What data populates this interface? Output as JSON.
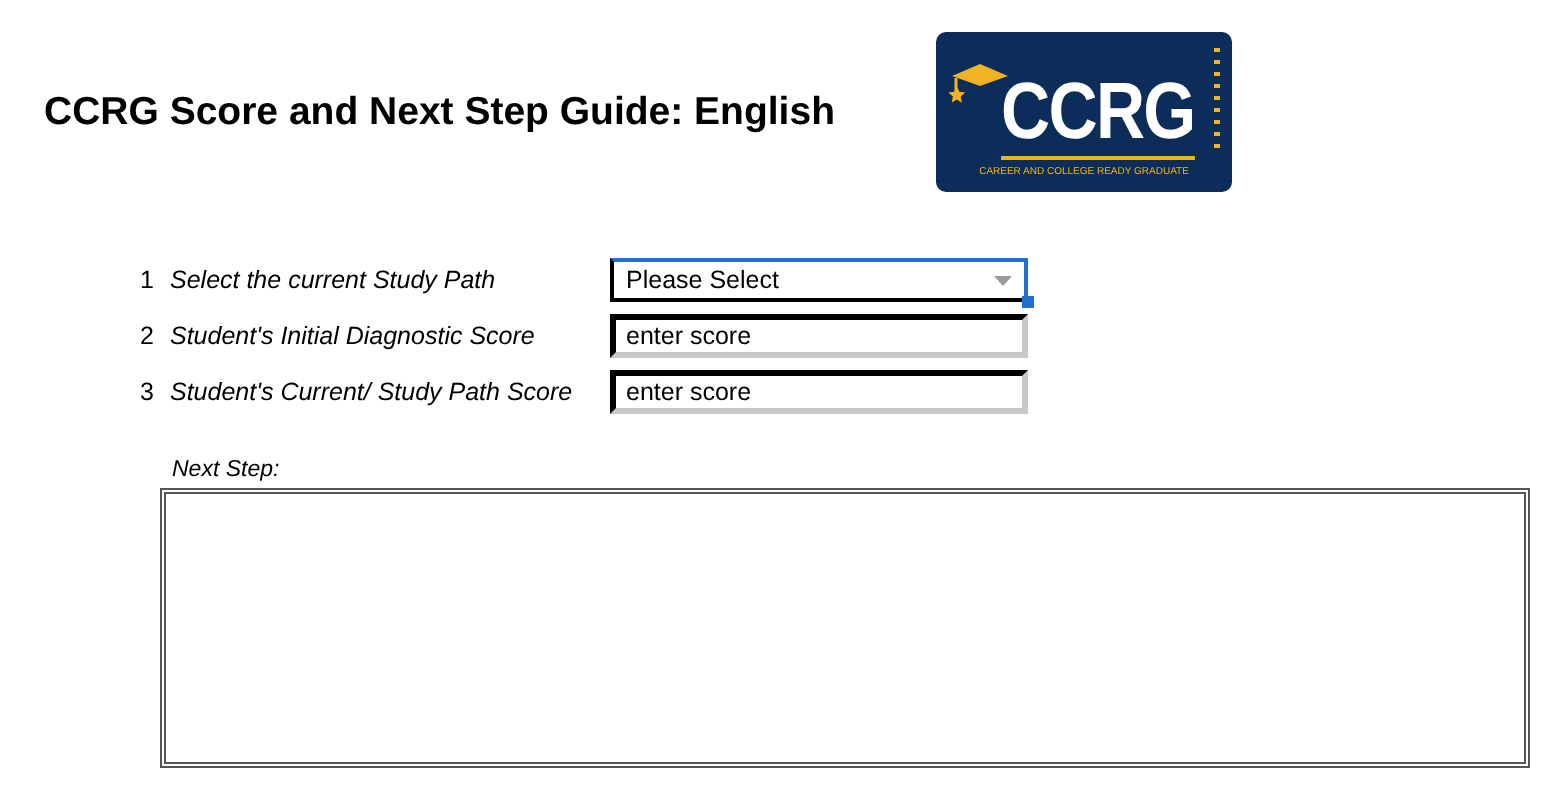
{
  "title": "CCRG Score and Next Step Guide: English",
  "logo": {
    "text": "CCRG",
    "tagline": "CAREER AND COLLEGE READY GRADUATE"
  },
  "fields": [
    {
      "number": "1",
      "label": "Select the current Study Path",
      "kind": "dropdown",
      "value": "Please Select",
      "focused": true
    },
    {
      "number": "2",
      "label": "Student's Initial Diagnostic Score",
      "kind": "input",
      "value": "enter score",
      "focused": false
    },
    {
      "number": "3",
      "label": "Student's Current/ Study Path Score",
      "kind": "input",
      "value": "enter score",
      "focused": false
    }
  ],
  "next_step": {
    "label": "Next Step:"
  }
}
